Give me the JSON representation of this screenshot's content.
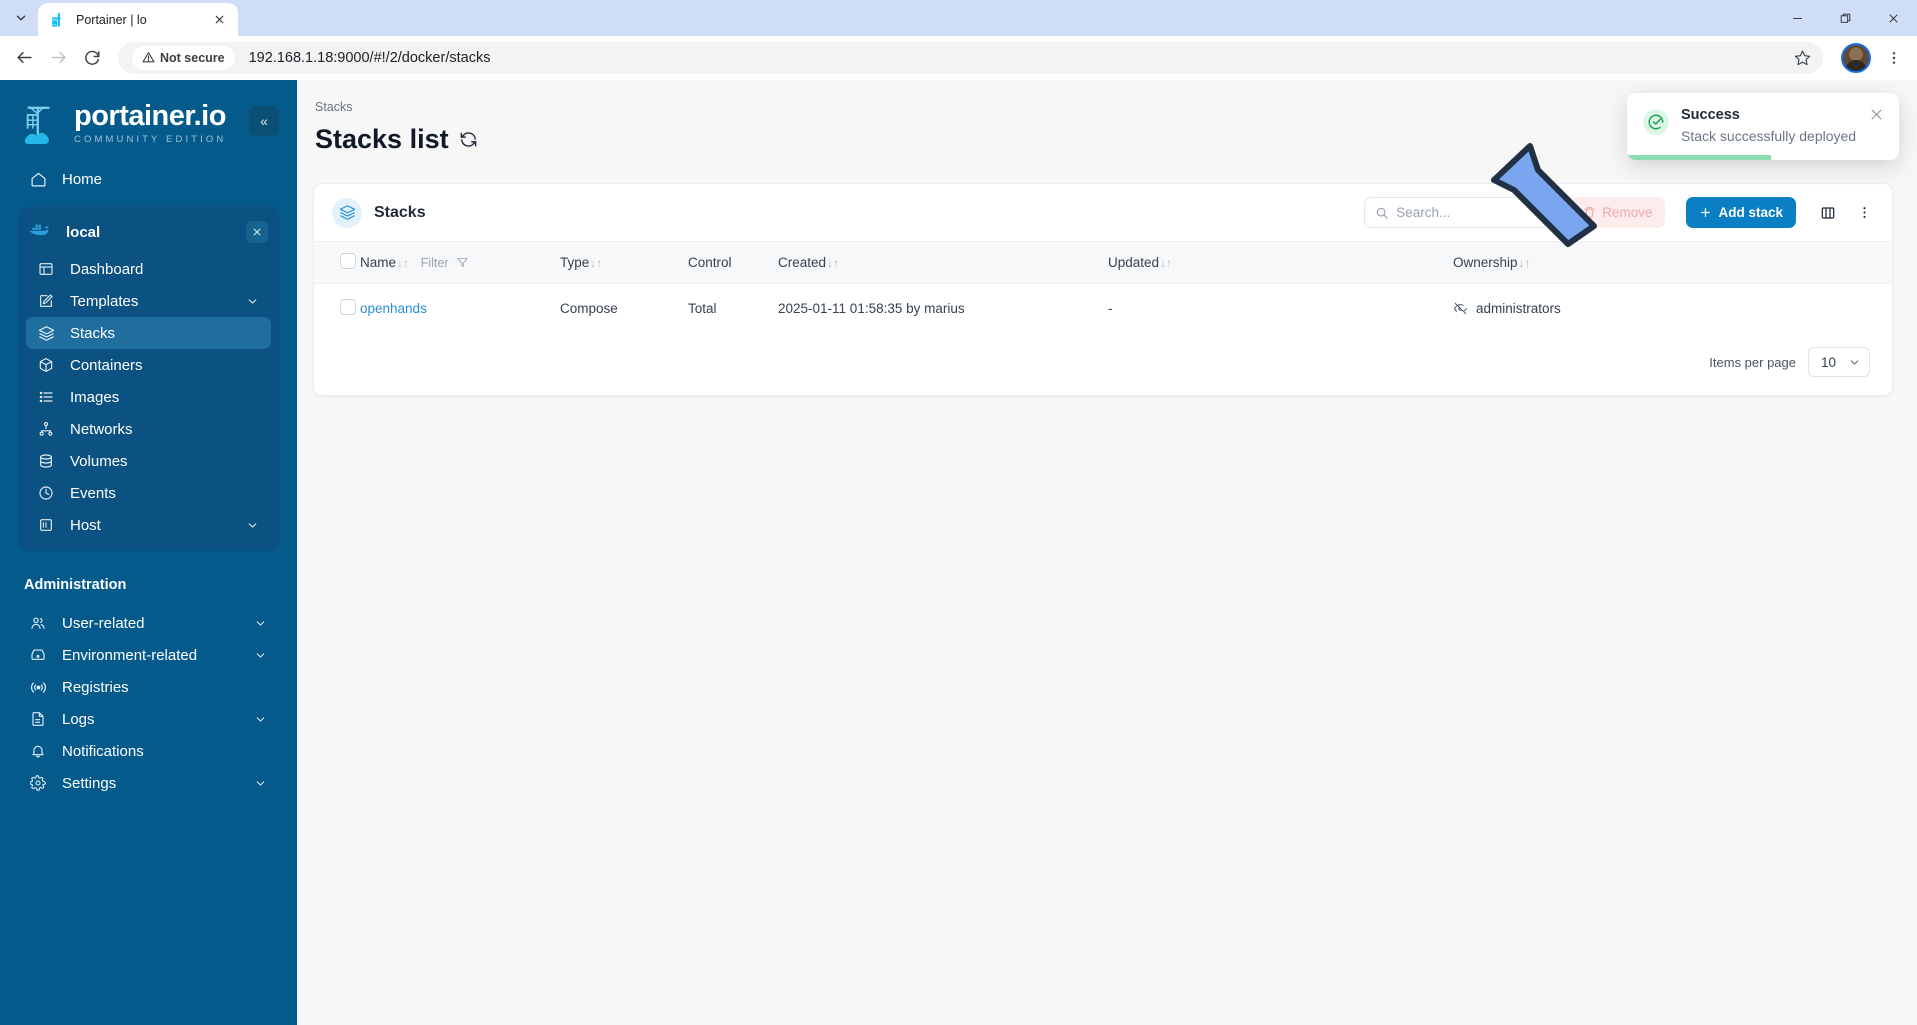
{
  "browser": {
    "tab": {
      "title": "Portainer | lo",
      "favicon": "portainer-favicon"
    },
    "tab_list_icon": "chevron-down-icon",
    "close_tab_icon": "close-icon",
    "window": {
      "minimize": "minimize-icon",
      "maximize": "restore-icon",
      "close": "close-icon"
    },
    "nav": {
      "back": "back-arrow-icon",
      "forward": "forward-arrow-icon",
      "reload": "reload-icon"
    },
    "omnibox": {
      "security_label": "Not secure",
      "security_icon": "warning-triangle-icon",
      "url": "192.168.1.18:9000/#!/2/docker/stacks",
      "bookmark_icon": "star-icon"
    },
    "profile_icon": "avatar",
    "menu_icon": "kebab-menu-icon"
  },
  "sidebar": {
    "brand": {
      "title": "portainer.io",
      "subtitle": "COMMUNITY EDITION",
      "logo": "portainer-crane-logo"
    },
    "collapse_label": "«",
    "home": {
      "label": "Home",
      "icon": "home-icon"
    },
    "environment": {
      "name": "local",
      "icon": "docker-whale-icon",
      "close_icon": "close-icon",
      "items": [
        {
          "label": "Dashboard",
          "icon": "dashboard-icon",
          "chevron": false,
          "active": false
        },
        {
          "label": "Templates",
          "icon": "template-edit-icon",
          "chevron": true,
          "active": false
        },
        {
          "label": "Stacks",
          "icon": "stacks-layers-icon",
          "chevron": false,
          "active": true
        },
        {
          "label": "Containers",
          "icon": "container-box-icon",
          "chevron": false,
          "active": false
        },
        {
          "label": "Images",
          "icon": "images-list-icon",
          "chevron": false,
          "active": false
        },
        {
          "label": "Networks",
          "icon": "networks-icon",
          "chevron": false,
          "active": false
        },
        {
          "label": "Volumes",
          "icon": "volumes-database-icon",
          "chevron": false,
          "active": false
        },
        {
          "label": "Events",
          "icon": "clock-icon",
          "chevron": false,
          "active": false
        },
        {
          "label": "Host",
          "icon": "host-server-icon",
          "chevron": true,
          "active": false
        }
      ]
    },
    "admin_section_title": "Administration",
    "admin_items": [
      {
        "label": "User-related",
        "icon": "users-icon",
        "chevron": true
      },
      {
        "label": "Environment-related",
        "icon": "environment-icon",
        "chevron": true
      },
      {
        "label": "Registries",
        "icon": "registries-broadcast-icon",
        "chevron": false
      },
      {
        "label": "Logs",
        "icon": "logs-document-icon",
        "chevron": true
      },
      {
        "label": "Notifications",
        "icon": "bell-icon",
        "chevron": false
      },
      {
        "label": "Settings",
        "icon": "gear-icon",
        "chevron": true
      }
    ]
  },
  "main": {
    "breadcrumb": "Stacks",
    "page_title": "Stacks list",
    "refresh_icon": "refresh-icon",
    "card": {
      "title": "Stacks",
      "icon": "stacks-layers-icon",
      "search": {
        "placeholder": "Search...",
        "value": "",
        "icon": "search-icon",
        "clear_icon": "close-icon"
      },
      "remove_button": {
        "label": "Remove",
        "icon": "trash-icon"
      },
      "add_button": {
        "label": "Add stack",
        "icon": "plus-icon"
      },
      "columns_icon": "columns-layout-icon",
      "more_icon": "kebab-menu-icon"
    },
    "table": {
      "select_all_checkbox": false,
      "columns": [
        {
          "key": "name",
          "label": "Name",
          "sort": "↓↑",
          "filter": "Filter",
          "filter_icon": "funnel-icon"
        },
        {
          "key": "type",
          "label": "Type",
          "sort": "↓↑"
        },
        {
          "key": "control",
          "label": "Control",
          "sort": ""
        },
        {
          "key": "created",
          "label": "Created",
          "sort": "↓↑"
        },
        {
          "key": "updated",
          "label": "Updated",
          "sort": "↓↑"
        },
        {
          "key": "ownership",
          "label": "Ownership",
          "sort": "↓↑"
        }
      ],
      "rows": [
        {
          "selected": false,
          "name": "openhands",
          "type": "Compose",
          "control": "Total",
          "created": "2025-01-11 01:58:35 by marius",
          "updated": "-",
          "ownership": "administrators",
          "ownership_icon": "eye-off-icon"
        }
      ]
    },
    "footer": {
      "items_per_page_label": "Items per page",
      "items_per_page_value": "10",
      "chevron_icon": "chevron-down-icon"
    }
  },
  "toast": {
    "title": "Success",
    "message": "Stack successfully deployed",
    "icon": "check-circle-icon",
    "close_icon": "close-icon",
    "progress_percent": 53
  },
  "annotation": {
    "arrow": "blue-arrow-pointing-down-right"
  },
  "colors": {
    "sidebar_bg": "#055a8c",
    "sidebar_panel_bg": "#0b5181",
    "sidebar_active": "#1f6e9e",
    "accent_blue": "#0a7fc4",
    "link_blue": "#2a8fd4",
    "success_green": "#17a34a",
    "toast_bar": "#8ddcb0",
    "remove_red": "#f0a9a9",
    "page_bg": "#f7f7f8"
  }
}
